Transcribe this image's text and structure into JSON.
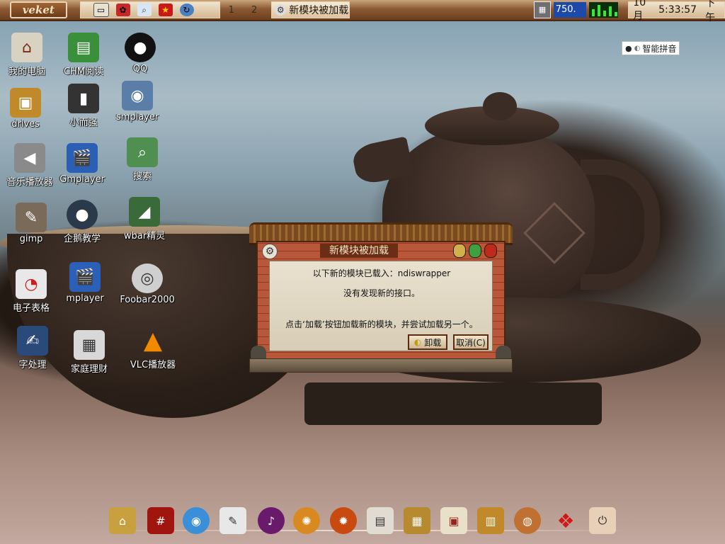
{
  "topbar": {
    "start_label": "veket",
    "workspaces": [
      "1",
      "2"
    ],
    "task_label": "新模块被加载",
    "meter_value": "750.",
    "clock_month": "10月",
    "clock_time": "5:33:57",
    "clock_ampm": "下午"
  },
  "ime": {
    "label": "智能拼音"
  },
  "desktop_icons": [
    {
      "label": "我的电脑"
    },
    {
      "label": "CHM阅读"
    },
    {
      "label": "QQ"
    },
    {
      "label": "drives"
    },
    {
      "label": "小而强"
    },
    {
      "label": "smplayer"
    },
    {
      "label": "音乐播放器"
    },
    {
      "label": "Gmplayer"
    },
    {
      "label": "搜索"
    },
    {
      "label": "gimp"
    },
    {
      "label": "企鹅教学"
    },
    {
      "label": "wbar精灵"
    },
    {
      "label": "电子表格"
    },
    {
      "label": "mplayer"
    },
    {
      "label": "Foobar2000"
    },
    {
      "label": "字处理"
    },
    {
      "label": "家庭理财"
    },
    {
      "label": "VLC播放器"
    }
  ],
  "dialog": {
    "title": "新模块被加载",
    "line1": "以下新的模块已载入：ndiswrapper",
    "line2": "没有发现新的接口。",
    "line3": "点击‘加载’按钮加载新的模块，并尝试加载另一个。",
    "unload_label": "卸载",
    "cancel_label": "取消(C)"
  },
  "colors": {
    "topbar": "#8b5a34",
    "dialog_frame": "#b8573a",
    "panel": "#e9e1cf",
    "meter": "#1d4aa8"
  }
}
